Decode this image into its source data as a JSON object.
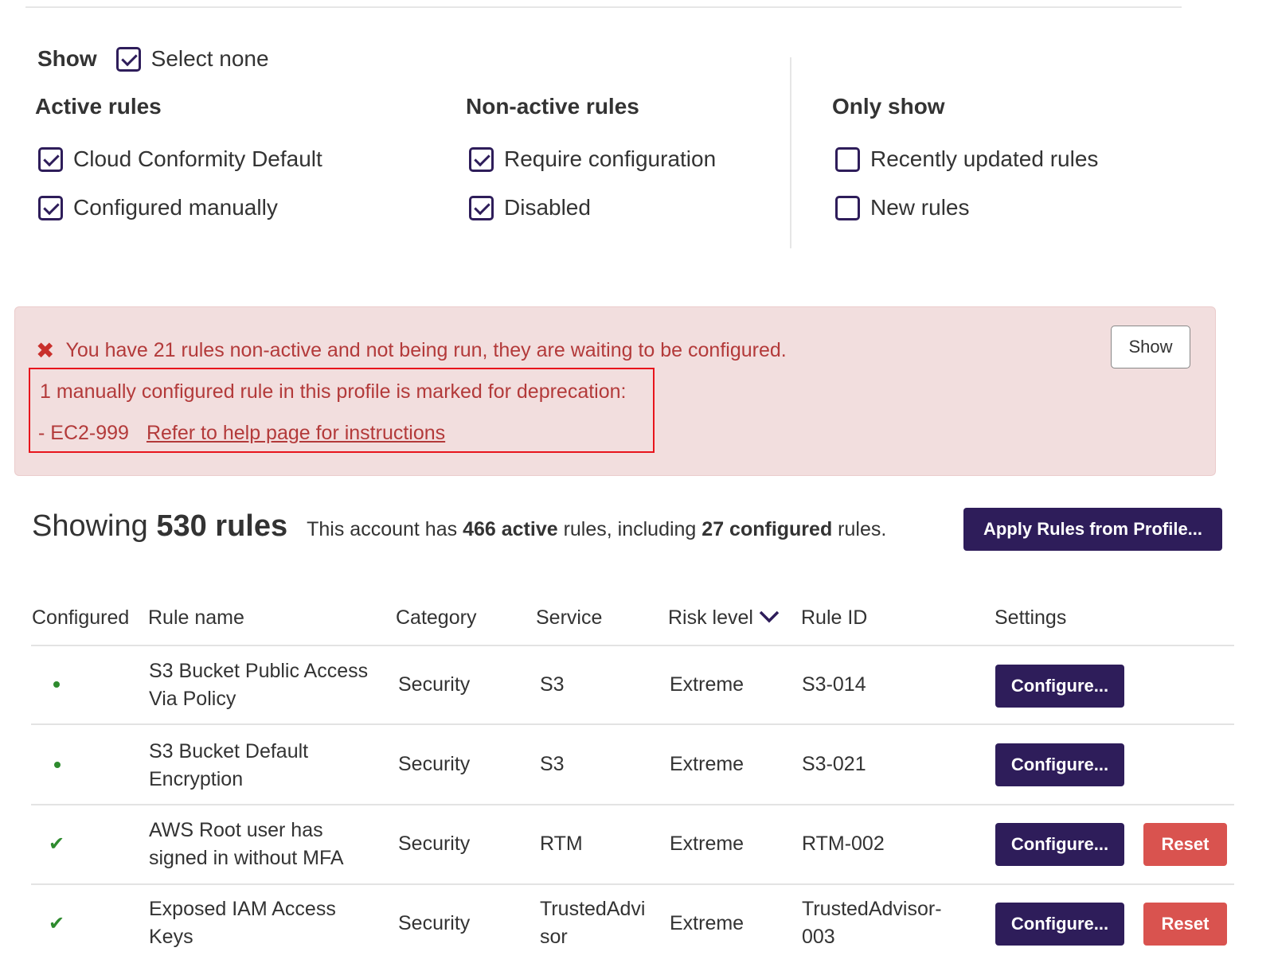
{
  "filters": {
    "show_label": "Show",
    "select_none_label": "Select none",
    "select_none_checked": true,
    "active": {
      "title": "Active rules",
      "items": [
        {
          "label": "Cloud Conformity Default",
          "checked": true
        },
        {
          "label": "Configured manually",
          "checked": true
        }
      ]
    },
    "nonactive": {
      "title": "Non-active rules",
      "items": [
        {
          "label": "Require configuration",
          "checked": true
        },
        {
          "label": "Disabled",
          "checked": true
        }
      ]
    },
    "only": {
      "title": "Only show",
      "items": [
        {
          "label": "Recently updated rules",
          "checked": false
        },
        {
          "label": "New rules",
          "checked": false
        }
      ]
    }
  },
  "alert": {
    "message": "You have 21 rules non-active and not being run, they are waiting to be configured.",
    "show_button": "Show",
    "deprecation_text": "1 manually configured rule in this profile is marked for deprecation:",
    "deprecated_rule": "- EC2-999",
    "help_link": "Refer to help page for instructions",
    "colors": {
      "background": "#f2dede",
      "text": "#b33a3a",
      "highlight_border": "#e8141c"
    }
  },
  "summary": {
    "showing_prefix": "Showing",
    "showing_count": "530 rules",
    "desc_1": "This account has",
    "active_count": "466 active",
    "desc_2": "rules, including",
    "configured_count": "27 configured",
    "desc_3": "rules.",
    "apply_button": "Apply Rules from Profile..."
  },
  "table": {
    "headers": {
      "configured": "Configured",
      "rule_name": "Rule name",
      "category": "Category",
      "service": "Service",
      "risk_level": "Risk level",
      "rule_id": "Rule ID",
      "settings": "Settings"
    },
    "sort_icon": "chevron-down-icon",
    "configure_label": "Configure...",
    "reset_label": "Reset",
    "rows": [
      {
        "configured": "dot",
        "name_1": "S3 Bucket Public Access",
        "name_2": "Via Policy",
        "category": "Security",
        "service_1": "S3",
        "service_2": "",
        "risk": "Extreme",
        "id_1": "S3-014",
        "id_2": "",
        "reset": false
      },
      {
        "configured": "dot",
        "name_1": "S3 Bucket Default",
        "name_2": "Encryption",
        "category": "Security",
        "service_1": "S3",
        "service_2": "",
        "risk": "Extreme",
        "id_1": "S3-021",
        "id_2": "",
        "reset": false
      },
      {
        "configured": "check",
        "name_1": "AWS Root user has",
        "name_2": "signed in without MFA",
        "category": "Security",
        "service_1": "RTM",
        "service_2": "",
        "risk": "Extreme",
        "id_1": "RTM-002",
        "id_2": "",
        "reset": true
      },
      {
        "configured": "check",
        "name_1": "Exposed IAM Access",
        "name_2": "Keys",
        "category": "Security",
        "service_1": "TrustedAdvi",
        "service_2": "sor",
        "risk": "Extreme",
        "id_1": "TrustedAdvisor-",
        "id_2": "003",
        "reset": true
      }
    ],
    "colors": {
      "primary_button": "#2e1d5a",
      "reset_button": "#d9534f",
      "configured_mark": "#2e8b2e"
    }
  }
}
